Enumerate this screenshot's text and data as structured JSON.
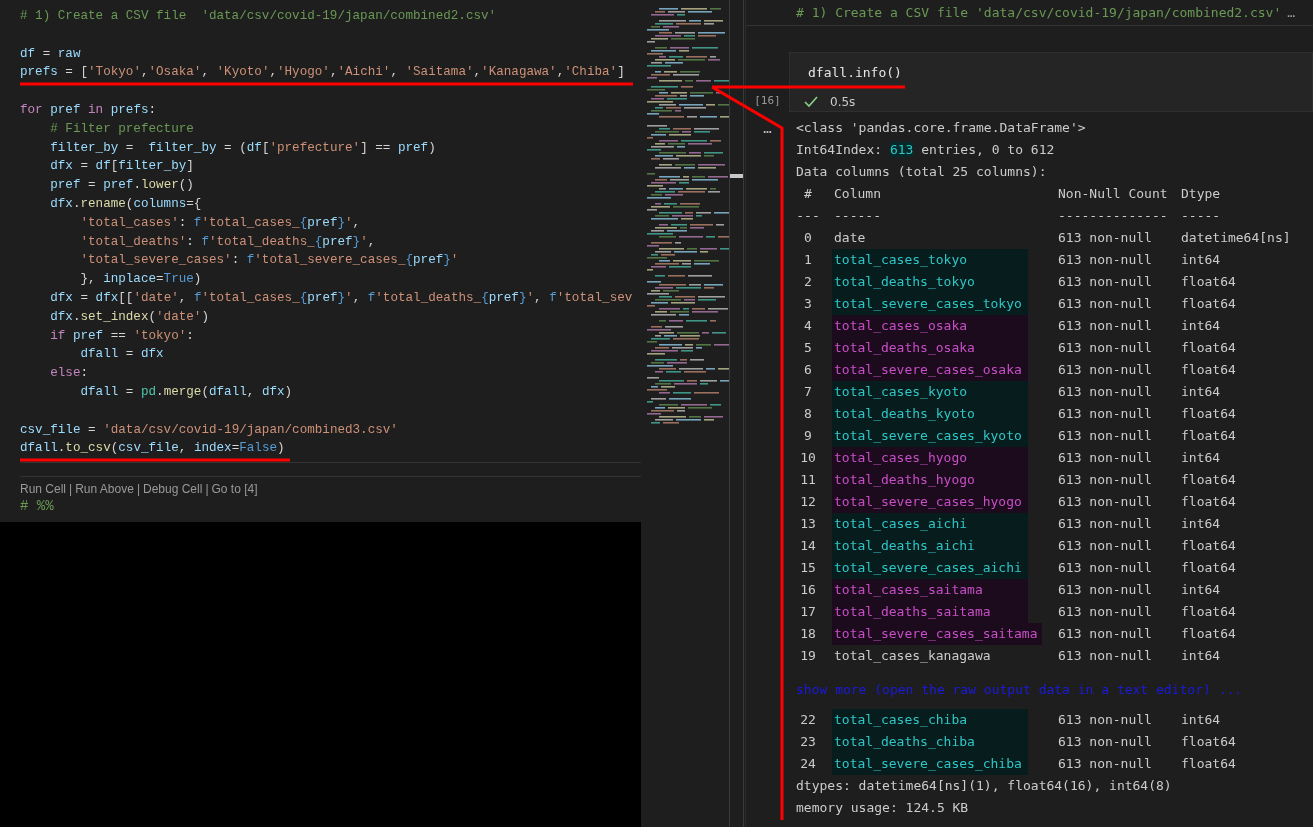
{
  "editor": {
    "lines": [
      {
        "tokens": [
          {
            "kind": "comment",
            "text": "# 1) Create a CSV file  'data/csv/covid-19/japan/combined2.csv'"
          }
        ]
      },
      {
        "blank_before": true,
        "tokens": [
          {
            "kind": "var",
            "text": "df"
          },
          {
            "kind": "punct",
            "text": " = "
          },
          {
            "kind": "var",
            "text": "raw"
          }
        ]
      },
      {
        "tokens": [
          {
            "kind": "var",
            "text": "prefs"
          },
          {
            "kind": "punct",
            "text": " = ["
          },
          {
            "kind": "string",
            "text": "'Tokyo'"
          },
          {
            "kind": "punct",
            "text": ","
          },
          {
            "kind": "string",
            "text": "'Osaka'"
          },
          {
            "kind": "punct",
            "text": ", "
          },
          {
            "kind": "string",
            "text": "'Kyoto'"
          },
          {
            "kind": "punct",
            "text": ","
          },
          {
            "kind": "string",
            "text": "'Hyogo'"
          },
          {
            "kind": "punct",
            "text": ","
          },
          {
            "kind": "string",
            "text": "'Aichi'"
          },
          {
            "kind": "punct",
            "text": ", "
          },
          {
            "kind": "string",
            "text": "'Saitama'"
          },
          {
            "kind": "punct",
            "text": ","
          },
          {
            "kind": "string",
            "text": "'Kanagawa'"
          },
          {
            "kind": "punct",
            "text": ","
          },
          {
            "kind": "string",
            "text": "'Chiba'"
          },
          {
            "kind": "punct",
            "text": "]"
          }
        ]
      },
      {
        "blank_before": true,
        "tokens": [
          {
            "kind": "keyword",
            "text": "for"
          },
          {
            "kind": "var",
            "text": " pref "
          },
          {
            "kind": "keyword",
            "text": "in"
          },
          {
            "kind": "var",
            "text": " prefs"
          },
          {
            "kind": "punct",
            "text": ":"
          }
        ]
      },
      {
        "tokens": [
          {
            "kind": "comment",
            "text": "    # Filter prefecture"
          }
        ]
      },
      {
        "tokens": [
          {
            "kind": "var",
            "text": "    filter_by"
          },
          {
            "kind": "punct",
            "text": " =  "
          },
          {
            "kind": "var",
            "text": "filter_by"
          },
          {
            "kind": "punct",
            "text": " = ("
          },
          {
            "kind": "var",
            "text": "df"
          },
          {
            "kind": "punct",
            "text": "["
          },
          {
            "kind": "string",
            "text": "'prefecture'"
          },
          {
            "kind": "punct",
            "text": "] == "
          },
          {
            "kind": "var",
            "text": "pref"
          },
          {
            "kind": "punct",
            "text": ")"
          }
        ]
      },
      {
        "tokens": [
          {
            "kind": "var",
            "text": "    dfx"
          },
          {
            "kind": "punct",
            "text": " = "
          },
          {
            "kind": "var",
            "text": "df"
          },
          {
            "kind": "punct",
            "text": "["
          },
          {
            "kind": "var",
            "text": "filter_by"
          },
          {
            "kind": "punct",
            "text": "]"
          }
        ]
      },
      {
        "tokens": [
          {
            "kind": "var",
            "text": "    pref"
          },
          {
            "kind": "punct",
            "text": " = "
          },
          {
            "kind": "var",
            "text": "pref"
          },
          {
            "kind": "punct",
            "text": "."
          },
          {
            "kind": "func",
            "text": "lower"
          },
          {
            "kind": "punct",
            "text": "()"
          }
        ]
      },
      {
        "tokens": [
          {
            "kind": "var",
            "text": "    dfx"
          },
          {
            "kind": "punct",
            "text": "."
          },
          {
            "kind": "func",
            "text": "rename"
          },
          {
            "kind": "punct",
            "text": "("
          },
          {
            "kind": "var",
            "text": "columns"
          },
          {
            "kind": "punct",
            "text": "={"
          }
        ]
      },
      {
        "tokens": [
          {
            "kind": "string",
            "text": "        'total_cases'"
          },
          {
            "kind": "punct",
            "text": ": "
          },
          {
            "kind": "blue",
            "text": "f"
          },
          {
            "kind": "string",
            "text": "'total_cases_"
          },
          {
            "kind": "blue",
            "text": "{"
          },
          {
            "kind": "var",
            "text": "pref"
          },
          {
            "kind": "blue",
            "text": "}"
          },
          {
            "kind": "string",
            "text": "'"
          },
          {
            "kind": "punct",
            "text": ","
          }
        ]
      },
      {
        "tokens": [
          {
            "kind": "string",
            "text": "        'total_deaths'"
          },
          {
            "kind": "punct",
            "text": ": "
          },
          {
            "kind": "blue",
            "text": "f"
          },
          {
            "kind": "string",
            "text": "'total_deaths_"
          },
          {
            "kind": "blue",
            "text": "{"
          },
          {
            "kind": "var",
            "text": "pref"
          },
          {
            "kind": "blue",
            "text": "}"
          },
          {
            "kind": "string",
            "text": "'"
          },
          {
            "kind": "punct",
            "text": ","
          }
        ]
      },
      {
        "tokens": [
          {
            "kind": "string",
            "text": "        'total_severe_cases'"
          },
          {
            "kind": "punct",
            "text": ": "
          },
          {
            "kind": "blue",
            "text": "f"
          },
          {
            "kind": "string",
            "text": "'total_severe_cases_"
          },
          {
            "kind": "blue",
            "text": "{"
          },
          {
            "kind": "var",
            "text": "pref"
          },
          {
            "kind": "blue",
            "text": "}"
          },
          {
            "kind": "string",
            "text": "'"
          }
        ]
      },
      {
        "tokens": [
          {
            "kind": "punct",
            "text": "        }, "
          },
          {
            "kind": "var",
            "text": "inplace"
          },
          {
            "kind": "punct",
            "text": "="
          },
          {
            "kind": "blue",
            "text": "True"
          },
          {
            "kind": "punct",
            "text": ")"
          }
        ]
      },
      {
        "tokens": [
          {
            "kind": "var",
            "text": "    dfx"
          },
          {
            "kind": "punct",
            "text": " = "
          },
          {
            "kind": "var",
            "text": "dfx"
          },
          {
            "kind": "punct",
            "text": "[["
          },
          {
            "kind": "string",
            "text": "'date'"
          },
          {
            "kind": "punct",
            "text": ", "
          },
          {
            "kind": "blue",
            "text": "f"
          },
          {
            "kind": "string",
            "text": "'total_cases_"
          },
          {
            "kind": "blue",
            "text": "{"
          },
          {
            "kind": "var",
            "text": "pref"
          },
          {
            "kind": "blue",
            "text": "}"
          },
          {
            "kind": "string",
            "text": "'"
          },
          {
            "kind": "punct",
            "text": ", "
          },
          {
            "kind": "blue",
            "text": "f"
          },
          {
            "kind": "string",
            "text": "'total_deaths_"
          },
          {
            "kind": "blue",
            "text": "{"
          },
          {
            "kind": "var",
            "text": "pref"
          },
          {
            "kind": "blue",
            "text": "}"
          },
          {
            "kind": "string",
            "text": "'"
          },
          {
            "kind": "punct",
            "text": ", "
          },
          {
            "kind": "blue",
            "text": "f"
          },
          {
            "kind": "string",
            "text": "'total_sev"
          }
        ]
      },
      {
        "tokens": [
          {
            "kind": "var",
            "text": "    dfx"
          },
          {
            "kind": "punct",
            "text": "."
          },
          {
            "kind": "func",
            "text": "set_index"
          },
          {
            "kind": "punct",
            "text": "("
          },
          {
            "kind": "string",
            "text": "'date'"
          },
          {
            "kind": "punct",
            "text": ")"
          }
        ]
      },
      {
        "tokens": [
          {
            "kind": "keyword",
            "text": "    if"
          },
          {
            "kind": "var",
            "text": " pref"
          },
          {
            "kind": "punct",
            "text": " == "
          },
          {
            "kind": "string",
            "text": "'tokyo'"
          },
          {
            "kind": "punct",
            "text": ":"
          }
        ]
      },
      {
        "tokens": [
          {
            "kind": "var",
            "text": "        dfall"
          },
          {
            "kind": "punct",
            "text": " = "
          },
          {
            "kind": "var",
            "text": "dfx"
          }
        ]
      },
      {
        "tokens": [
          {
            "kind": "keyword",
            "text": "    else"
          },
          {
            "kind": "punct",
            "text": ":"
          }
        ]
      },
      {
        "tokens": [
          {
            "kind": "var",
            "text": "        dfall"
          },
          {
            "kind": "punct",
            "text": " = "
          },
          {
            "kind": "type",
            "text": "pd"
          },
          {
            "kind": "punct",
            "text": "."
          },
          {
            "kind": "func",
            "text": "merge"
          },
          {
            "kind": "punct",
            "text": "("
          },
          {
            "kind": "var",
            "text": "dfall"
          },
          {
            "kind": "punct",
            "text": ", "
          },
          {
            "kind": "var",
            "text": "dfx"
          },
          {
            "kind": "punct",
            "text": ")"
          }
        ]
      },
      {
        "blank_before": true,
        "tokens": [
          {
            "kind": "var",
            "text": "csv_file"
          },
          {
            "kind": "punct",
            "text": " = "
          },
          {
            "kind": "string",
            "text": "'data/csv/covid-19/japan/combined3.csv'"
          }
        ]
      },
      {
        "tokens": [
          {
            "kind": "var",
            "text": "dfall"
          },
          {
            "kind": "punct",
            "text": "."
          },
          {
            "kind": "func",
            "text": "to_csv"
          },
          {
            "kind": "punct",
            "text": "("
          },
          {
            "kind": "var",
            "text": "csv_file"
          },
          {
            "kind": "punct",
            "text": ", "
          },
          {
            "kind": "var",
            "text": "index"
          },
          {
            "kind": "punct",
            "text": "="
          },
          {
            "kind": "blue",
            "text": "False"
          },
          {
            "kind": "punct",
            "text": ")"
          }
        ]
      }
    ],
    "codelens": [
      "Run Cell",
      "Run Above",
      "Debug Cell",
      "Go to [4]"
    ],
    "codelens_separator": "|",
    "cell_marker": "# %%"
  },
  "notebook": {
    "collapsed_cell": {
      "text": "# 1) Create a CSV file 'data/csv/covid-19/japan/combined2.csv'",
      "ellipsis": "…"
    },
    "cell": {
      "code": "dfall.info()",
      "execution_count": "[16]",
      "duration": "0.5s"
    },
    "output": {
      "more_button": "…",
      "class_line": "<class 'pandas.core.frame.DataFrame'>",
      "index_line": {
        "prefix": "Int64Index:",
        "count": "613",
        "suffix": "entries, 0 to 612"
      },
      "columns_line": "Data columns (total 25 columns):",
      "header": {
        "index": "#",
        "column": "Column",
        "count": "Non-Null Count",
        "dtype": "Dtype"
      },
      "separator": {
        "index": "---",
        "column": "------",
        "count": "--------------",
        "dtype": "-----"
      },
      "rows": [
        {
          "index": "0",
          "column": "date",
          "count": "613 non-null",
          "dtype": "datetime64[ns]"
        },
        {
          "index": "1",
          "column": "total_cases_tokyo",
          "count": "613 non-null",
          "dtype": "int64",
          "color": "#2fc6c6"
        },
        {
          "index": "2",
          "column": "total_deaths_tokyo",
          "count": "613 non-null",
          "dtype": "float64",
          "color": "#2fc6c6"
        },
        {
          "index": "3",
          "column": "total_severe_cases_tokyo",
          "count": "613 non-null",
          "dtype": "float64",
          "color": "#2fc6c6"
        },
        {
          "index": "4",
          "column": "total_cases_osaka",
          "count": "613 non-null",
          "dtype": "int64",
          "color": "#c84ec8"
        },
        {
          "index": "5",
          "column": "total_deaths_osaka",
          "count": "613 non-null",
          "dtype": "float64",
          "color": "#c84ec8"
        },
        {
          "index": "6",
          "column": "total_severe_cases_osaka",
          "count": "613 non-null",
          "dtype": "float64",
          "color": "#c84ec8"
        },
        {
          "index": "7",
          "column": "total_cases_kyoto",
          "count": "613 non-null",
          "dtype": "int64",
          "color": "#2fc6c6"
        },
        {
          "index": "8",
          "column": "total_deaths_kyoto",
          "count": "613 non-null",
          "dtype": "float64",
          "color": "#2fc6c6"
        },
        {
          "index": "9",
          "column": "total_severe_cases_kyoto",
          "count": "613 non-null",
          "dtype": "float64",
          "color": "#2fc6c6"
        },
        {
          "index": "10",
          "column": "total_cases_hyogo",
          "count": "613 non-null",
          "dtype": "int64",
          "color": "#c84ec8"
        },
        {
          "index": "11",
          "column": "total_deaths_hyogo",
          "count": "613 non-null",
          "dtype": "float64",
          "color": "#c84ec8"
        },
        {
          "index": "12",
          "column": "total_severe_cases_hyogo",
          "count": "613 non-null",
          "dtype": "float64",
          "color": "#c84ec8"
        },
        {
          "index": "13",
          "column": "total_cases_aichi",
          "count": "613 non-null",
          "dtype": "int64",
          "color": "#2fc6c6"
        },
        {
          "index": "14",
          "column": "total_deaths_aichi",
          "count": "613 non-null",
          "dtype": "float64",
          "color": "#2fc6c6"
        },
        {
          "index": "15",
          "column": "total_severe_cases_aichi",
          "count": "613 non-null",
          "dtype": "float64",
          "color": "#2fc6c6"
        },
        {
          "index": "16",
          "column": "total_cases_saitama",
          "count": "613 non-null",
          "dtype": "int64",
          "color": "#c84ec8"
        },
        {
          "index": "17",
          "column": "total_deaths_saitama",
          "count": "613 non-null",
          "dtype": "float64",
          "color": "#c84ec8"
        },
        {
          "index": "18",
          "column": "total_severe_cases_saitama",
          "count": "613 non-null",
          "dtype": "float64",
          "color": "#c84ec8"
        },
        {
          "index": "19",
          "column": "total_cases_kanagawa",
          "count": "613 non-null",
          "dtype": "int64"
        }
      ],
      "show_more": "show more (open the raw output data in a text editor) ...",
      "rows_after": [
        {
          "index": "22",
          "column": "total_cases_chiba",
          "count": "613 non-null",
          "dtype": "int64",
          "color": "#2fc6c6"
        },
        {
          "index": "23",
          "column": "total_deaths_chiba",
          "count": "613 non-null",
          "dtype": "float64",
          "color": "#2fc6c6"
        },
        {
          "index": "24",
          "column": "total_severe_cases_chiba",
          "count": "613 non-null",
          "dtype": "float64",
          "color": "#2fc6c6"
        }
      ],
      "dtypes_line": "dtypes: datetime64[ns](1), float64(16), int64(8)",
      "memory_line": "memory usage: 124.5 KB"
    }
  }
}
